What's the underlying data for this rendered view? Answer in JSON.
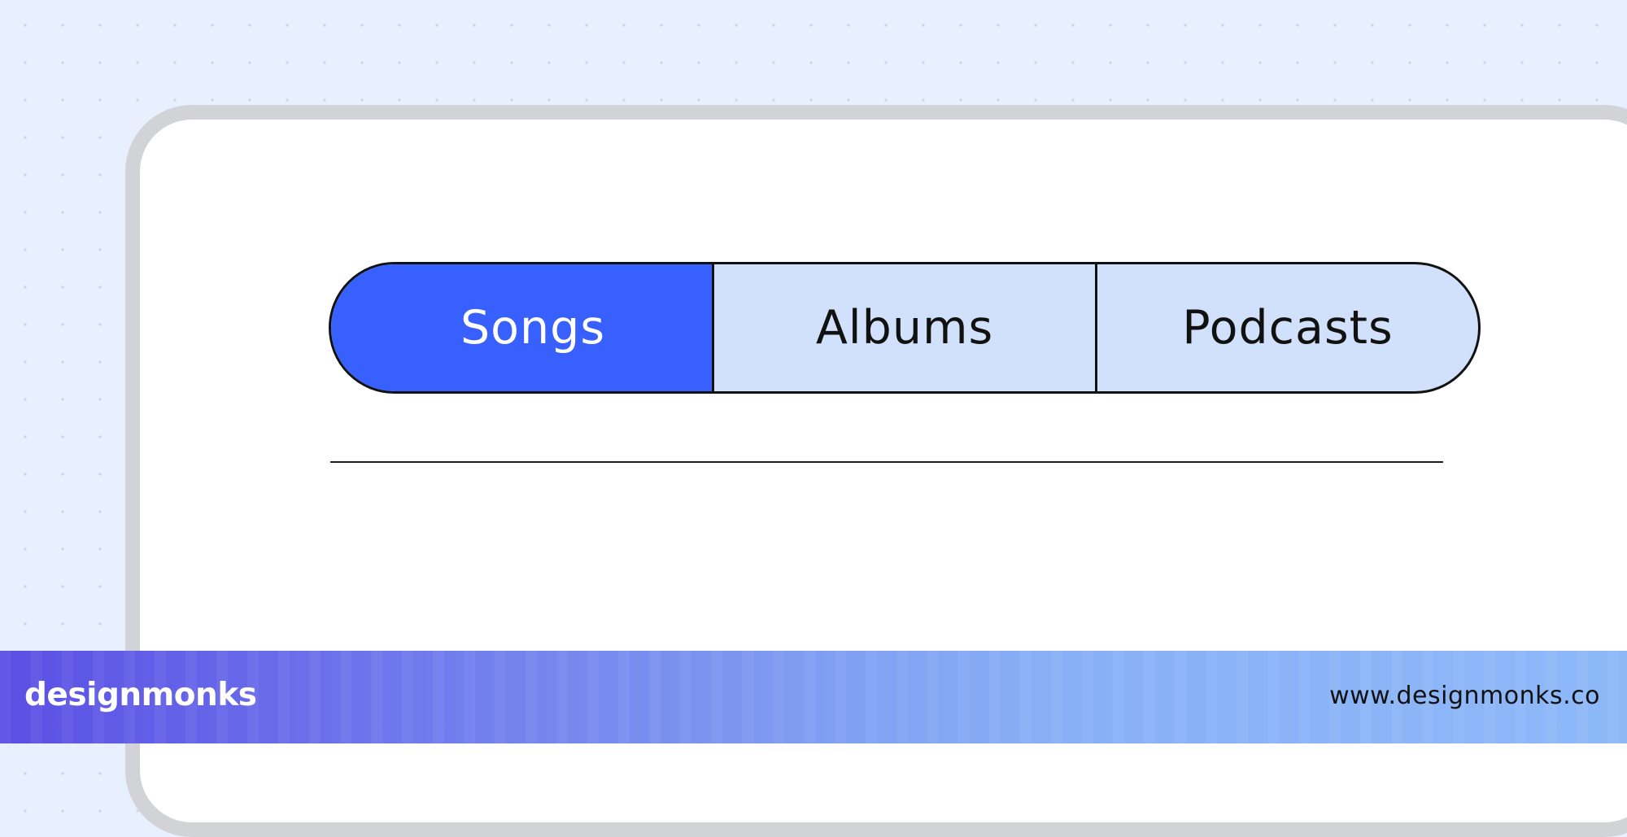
{
  "segmented_control": {
    "tabs": [
      {
        "label": "Songs",
        "active": true
      },
      {
        "label": "Albums",
        "active": false
      },
      {
        "label": "Podcasts",
        "active": false
      }
    ]
  },
  "footer": {
    "brand": "designmonks",
    "url": "www.designmonks.co"
  },
  "colors": {
    "active_tab": "#3760ff",
    "inactive_tab": "#d1e1fc",
    "background": "#e8efff",
    "frame": "#d2d3d6"
  }
}
